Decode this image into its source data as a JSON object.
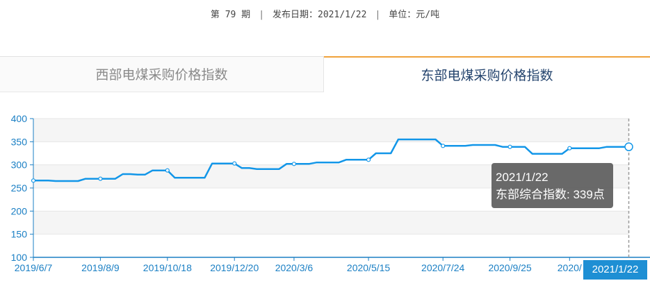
{
  "info": {
    "issue": "第 79 期",
    "release": "发布日期：2021/1/22",
    "unit": "单位：元/吨",
    "separator": "|"
  },
  "tabs": [
    {
      "label": "西部电煤采购价格指数",
      "active": false
    },
    {
      "label": "东部电煤采购价格指数",
      "active": true
    }
  ],
  "tooltip": {
    "date": "2021/1/22",
    "text": "东部综合指数: 339点"
  },
  "pointer_label": "2021/1/22",
  "colors": {
    "line": "#1296e8",
    "axis": "#1a7fc4",
    "tab_active_border": "#f0a23a",
    "pointer_label_bg": "#1e8fd4"
  },
  "chart_data": {
    "type": "line",
    "title": "",
    "xlabel": "",
    "ylabel": "",
    "ylim": [
      100,
      400
    ],
    "yticks": [
      100,
      150,
      200,
      250,
      300,
      350,
      400
    ],
    "x_tick_labels": [
      "2019/6/7",
      "2019/8/9",
      "2019/10/18",
      "2019/12/20",
      "2020/3/6",
      "2020/5/15",
      "2020/7/24",
      "2020/9/25",
      "2020/",
      "2021/1/22"
    ],
    "grid": true,
    "series": [
      {
        "name": "东部综合指数",
        "x": [
          "2019/6/7",
          "2019/6/14",
          "2019/6/21",
          "2019/6/28",
          "2019/7/5",
          "2019/7/12",
          "2019/7/19",
          "2019/7/26",
          "2019/8/2",
          "2019/8/9",
          "2019/8/16",
          "2019/8/23",
          "2019/8/30",
          "2019/9/6",
          "2019/9/13",
          "2019/9/20",
          "2019/9/27",
          "2019/10/11",
          "2019/10/18",
          "2019/10/25",
          "2019/11/1",
          "2019/11/8",
          "2019/11/15",
          "2019/11/22",
          "2019/11/29",
          "2019/12/6",
          "2019/12/13",
          "2019/12/20",
          "2019/12/27",
          "2020/1/3",
          "2020/1/10",
          "2020/1/17",
          "2020/2/14",
          "2020/2/21",
          "2020/2/28",
          "2020/3/6",
          "2020/3/13",
          "2020/3/20",
          "2020/3/27",
          "2020/4/3",
          "2020/4/10",
          "2020/4/17",
          "2020/4/24",
          "2020/5/1",
          "2020/5/8",
          "2020/5/15",
          "2020/5/22",
          "2020/5/29",
          "2020/6/5",
          "2020/6/12",
          "2020/6/19",
          "2020/6/26",
          "2020/7/3",
          "2020/7/10",
          "2020/7/17",
          "2020/7/24",
          "2020/7/31",
          "2020/8/7",
          "2020/8/14",
          "2020/8/21",
          "2020/8/28",
          "2020/9/4",
          "2020/9/11",
          "2020/9/18",
          "2020/9/25",
          "2020/10/9",
          "2020/10/16",
          "2020/10/23",
          "2020/10/30",
          "2020/11/6",
          "2020/11/13",
          "2020/11/20",
          "2020/11/27",
          "2020/12/4",
          "2020/12/11",
          "2020/12/18",
          "2020/12/25",
          "2021/1/1",
          "2021/1/8",
          "2021/1/15",
          "2021/1/22"
        ],
        "values": [
          266,
          266,
          266,
          265,
          265,
          265,
          265,
          270,
          270,
          270,
          270,
          270,
          280,
          280,
          279,
          279,
          288,
          288,
          288,
          272,
          272,
          272,
          272,
          272,
          303,
          303,
          303,
          303,
          293,
          293,
          291,
          291,
          291,
          291,
          302,
          302,
          302,
          302,
          305,
          305,
          305,
          305,
          311,
          311,
          311,
          311,
          325,
          325,
          325,
          355,
          355,
          355,
          355,
          355,
          355,
          341,
          341,
          341,
          341,
          343,
          343,
          343,
          343,
          339,
          339,
          339,
          339,
          324,
          324,
          324,
          324,
          324,
          336,
          336,
          336,
          336,
          336,
          339,
          339,
          339,
          339
        ]
      }
    ],
    "markers_at": [
      "2019/6/7",
      "2019/8/9",
      "2019/10/18",
      "2019/12/20",
      "2020/3/6",
      "2020/5/15",
      "2020/7/24",
      "2020/9/25",
      "2020/11/27",
      "2021/1/22"
    ],
    "highlight": {
      "x": "2021/1/22",
      "y": 339
    }
  }
}
